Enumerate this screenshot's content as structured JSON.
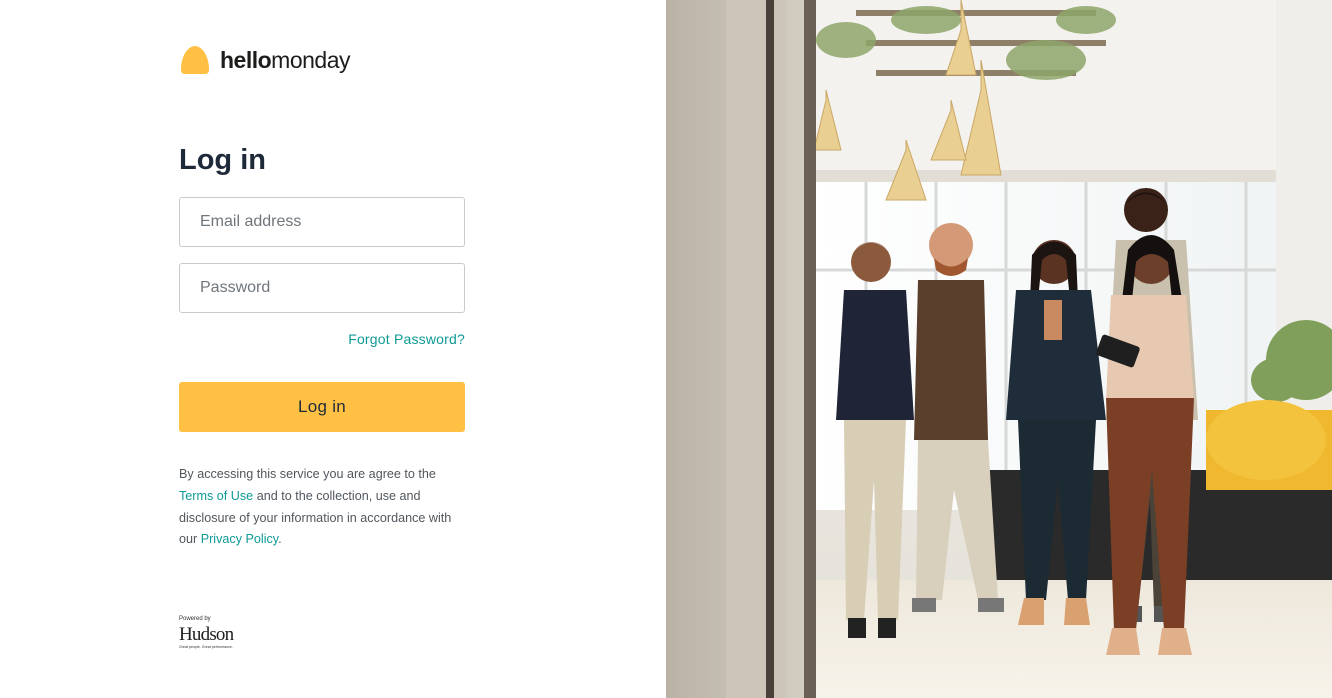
{
  "brand": {
    "name_part1": "hello",
    "name_part2": "monday",
    "logo_color": "#ffc043"
  },
  "login": {
    "heading": "Log in",
    "email_placeholder": "Email address",
    "password_placeholder": "Password",
    "forgot_password": "Forgot Password?",
    "submit_label": "Log in"
  },
  "legal": {
    "text_before_terms": "By accessing this service you are agree to the",
    "terms_link": "Terms of Use",
    "text_middle": "and to the collection, use and disclosure of your information in accordance with our",
    "privacy_link": "Privacy Policy",
    "text_end": "."
  },
  "footer": {
    "powered_by": "Powered by",
    "partner_logo": "Hudson",
    "partner_tagline": "Great people. Great performance."
  },
  "colors": {
    "accent": "#ffc043",
    "link": "#0e9a95",
    "heading": "#1e2a3a"
  },
  "hero_image": {
    "icon": "office-team-photo"
  }
}
